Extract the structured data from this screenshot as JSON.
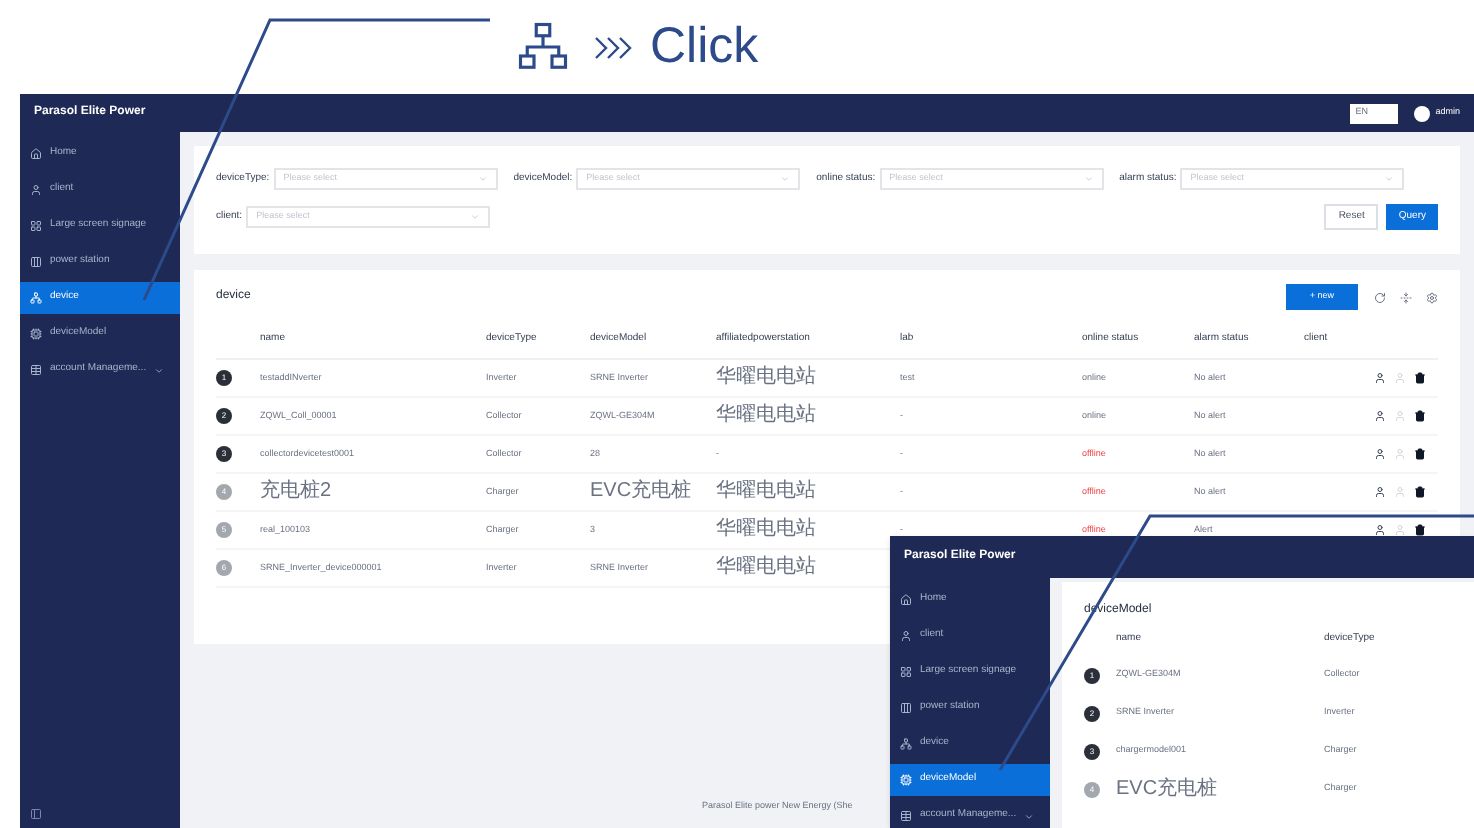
{
  "callout": {
    "text": "Click"
  },
  "app": {
    "brand": "Parasol Elite Power",
    "language": "EN",
    "user": "admin",
    "sidebar": [
      {
        "label": "Home",
        "selected": false
      },
      {
        "label": "client",
        "selected": false
      },
      {
        "label": "Large screen signage",
        "selected": false
      },
      {
        "label": "power station",
        "selected": false
      },
      {
        "label": "device",
        "selected": true
      },
      {
        "label": "deviceModel",
        "selected": false
      },
      {
        "label": "account Manageme...",
        "selected": false,
        "expandable": true
      }
    ],
    "filters": [
      {
        "label": "deviceType:",
        "placeholder": "Please select"
      },
      {
        "label": "deviceModel:",
        "placeholder": "Please select"
      },
      {
        "label": "online status:",
        "placeholder": "Please select"
      },
      {
        "label": "alarm status:",
        "placeholder": "Please select"
      },
      {
        "label": "client:",
        "placeholder": "Please select"
      }
    ],
    "reset_button": "Reset",
    "query_button": "Query",
    "table": {
      "title": "device",
      "new_button": "+ new",
      "columns": [
        "name",
        "deviceType",
        "deviceModel",
        "affiliatedpowerstation",
        "lab",
        "online status",
        "alarm status",
        "client"
      ],
      "rows": [
        {
          "index": "1",
          "top": true,
          "cells": [
            "testaddINverter",
            "Inverter",
            "SRNE Inverter",
            "华曜电电站",
            "test"
          ],
          "online_status": "online",
          "online": true,
          "after": [
            "No alert"
          ],
          "actions": true
        },
        {
          "index": "2",
          "top": true,
          "cells": [
            "ZQWL_Coll_00001",
            "Collector",
            "ZQWL-GE304M",
            "华曜电电站",
            "-"
          ],
          "online_status": "online",
          "online": true,
          "after": [
            "No alert"
          ],
          "actions": true
        },
        {
          "index": "3",
          "top": true,
          "cells": [
            "collectordevicetest0001",
            "Collector",
            "28",
            "-",
            "-"
          ],
          "online_status": "offline",
          "online": false,
          "after": [
            "No alert"
          ],
          "actions": true
        },
        {
          "index": "4",
          "top": false,
          "cells": [
            "充电桩2",
            "Charger",
            "EVC充电桩",
            "华曜电电站",
            "-"
          ],
          "online_status": "offline",
          "online": false,
          "after": [
            "No alert"
          ],
          "actions": true
        },
        {
          "index": "5",
          "top": false,
          "cells": [
            "real_100103",
            "Charger",
            "3",
            "华曜电电站",
            "-"
          ],
          "online_status": "offline",
          "online": false,
          "after": [
            "Alert"
          ],
          "actions": true
        },
        {
          "index": "6",
          "top": false,
          "cells": [
            "SRNE_Inverter_device000001",
            "Inverter",
            "SRNE Inverter",
            "华曜电电站"
          ],
          "actions": false
        }
      ]
    },
    "footer": "Parasol Elite power New Energy (She"
  },
  "inset": {
    "brand": "Parasol Elite Power",
    "sidebar": [
      {
        "label": "Home",
        "selected": false
      },
      {
        "label": "client",
        "selected": false
      },
      {
        "label": "Large screen signage",
        "selected": false
      },
      {
        "label": "power station",
        "selected": false
      },
      {
        "label": "device",
        "selected": false
      },
      {
        "label": "deviceModel",
        "selected": true
      },
      {
        "label": "account Manageme...",
        "selected": false,
        "expandable": true
      }
    ],
    "table": {
      "title": "deviceModel",
      "columns": [
        "name",
        "deviceType"
      ],
      "rows": [
        {
          "index": "1",
          "top": true,
          "cells": [
            "ZQWL-GE304M",
            "Collector"
          ]
        },
        {
          "index": "2",
          "top": true,
          "cells": [
            "SRNE Inverter",
            "Inverter"
          ]
        },
        {
          "index": "3",
          "top": true,
          "cells": [
            "chargermodel001",
            "Charger"
          ]
        },
        {
          "index": "4",
          "top": false,
          "cells": [
            "EVC充电桩",
            "Charger"
          ]
        }
      ]
    }
  }
}
